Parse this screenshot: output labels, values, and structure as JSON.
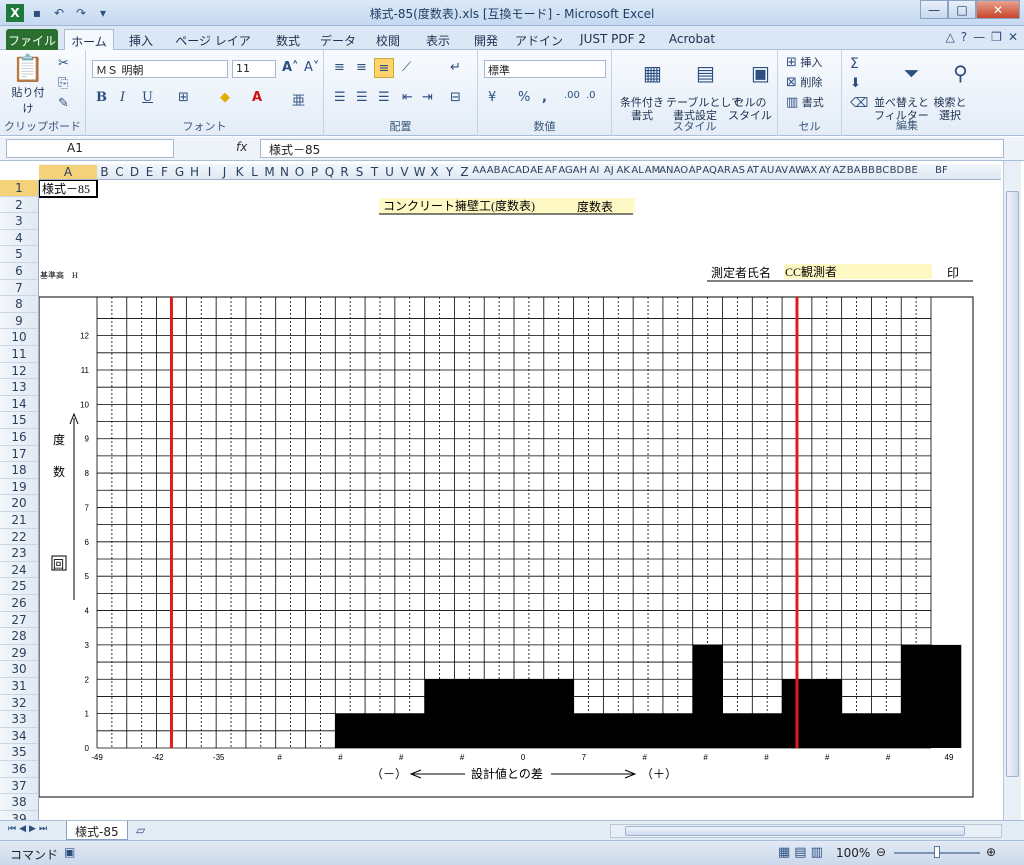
{
  "window": {
    "title": "様式-85(度数表).xls  [互換モード] - Microsoft Excel"
  },
  "ribbon_tabs": [
    "ファイル",
    "ホーム",
    "挿入",
    "ページ レイアウト",
    "数式",
    "データ",
    "校閲",
    "表示",
    "開発",
    "アドイン",
    "JUST PDF 2",
    "Acrobat"
  ],
  "ribbon": {
    "clipboard": {
      "paste": "貼り付け",
      "label": "クリップボード"
    },
    "font": {
      "name": "ＭＳ 明朝",
      "size": "11",
      "label": "フォント",
      "bold": "B",
      "italic": "I",
      "underline": "U"
    },
    "alignment": {
      "label": "配置"
    },
    "number": {
      "format": "標準",
      "label": "数値",
      "percent": "%",
      "comma": ","
    },
    "styles": {
      "cond": "条件付き\n書式",
      "table": "テーブルとして\n書式設定",
      "cell": "セルの\nスタイル",
      "label": "スタイル"
    },
    "cells": {
      "insert": "挿入",
      "delete": "削除",
      "format": "書式",
      "label": "セル"
    },
    "editing": {
      "sum": "Σ",
      "sort": "並べ替えと\nフィルター",
      "find": "検索と\n選択",
      "label": "編集"
    }
  },
  "formula_bar": {
    "name_box": "A1",
    "fx": "fx",
    "content": "様式－85"
  },
  "columns": [
    "A",
    "B",
    "C",
    "D",
    "E",
    "F",
    "G",
    "H",
    "I",
    "J",
    "K",
    "L",
    "M",
    "N",
    "O",
    "P",
    "Q",
    "R",
    "S",
    "T",
    "U",
    "V",
    "W",
    "X",
    "Y",
    "Z",
    "AA",
    "AB",
    "AC",
    "AD",
    "AE",
    "AF",
    "AG",
    "AH",
    "AI",
    "AJ",
    "AK",
    "AL",
    "AM",
    "AN",
    "AO",
    "AP",
    "AQ",
    "AR",
    "AS",
    "AT",
    "AU",
    "AV",
    "AW",
    "AX",
    "AY",
    "AZ",
    "BA",
    "BB",
    "BC",
    "BD",
    "BE",
    "BF"
  ],
  "rows": [
    "1",
    "2",
    "3",
    "4",
    "5",
    "6",
    "7",
    "8",
    "9",
    "10",
    "11",
    "12",
    "13",
    "14",
    "15",
    "16",
    "17",
    "18",
    "19",
    "20",
    "21",
    "22",
    "23",
    "24",
    "25",
    "26",
    "27",
    "28",
    "29",
    "30",
    "31",
    "32",
    "33",
    "34",
    "35",
    "36",
    "37",
    "38",
    "39"
  ],
  "sheet": {
    "a1": "様式－85",
    "title": "コンクリート擁壁工(度数表)",
    "title_suffix": "度数表",
    "base_height": "基準高　H",
    "observer_label": "測定者氏名",
    "observer": "CC観測者",
    "seal": "印",
    "y_label_1": "度",
    "y_label_2": "数",
    "y_label_3": "回",
    "x_label_minus": "（－）",
    "x_label_mid": "設計値との差",
    "x_label_plus": "（＋）"
  },
  "chart_data": {
    "type": "bar",
    "title": "コンクリート擁壁工(度数表)",
    "ylabel": "度数 回",
    "xlabel": "設計値との差",
    "y_ticks": [
      "0",
      "1",
      "2",
      "3",
      "4",
      "5",
      "6",
      "7",
      "8",
      "9",
      "10",
      "11",
      "12"
    ],
    "x_ticks": [
      "-49",
      "-42",
      "-35",
      "#",
      "#",
      "#",
      "#",
      "0",
      "7",
      "#",
      "#",
      "#",
      "#",
      "#",
      "49"
    ],
    "ylim": [
      0,
      12
    ],
    "bin_count": 28,
    "first_bin": 8,
    "values": [
      1,
      1,
      1,
      2,
      2,
      2,
      2,
      2,
      1,
      1,
      1,
      1,
      3,
      1,
      1,
      2,
      2,
      1,
      1,
      3,
      3
    ],
    "limit_lines": {
      "color": "#e01b1b",
      "bins": [
        2,
        23
      ]
    }
  },
  "sheet_tabs": [
    "様式-85"
  ],
  "status": {
    "mode": "コマンド",
    "zoom": "100%"
  }
}
